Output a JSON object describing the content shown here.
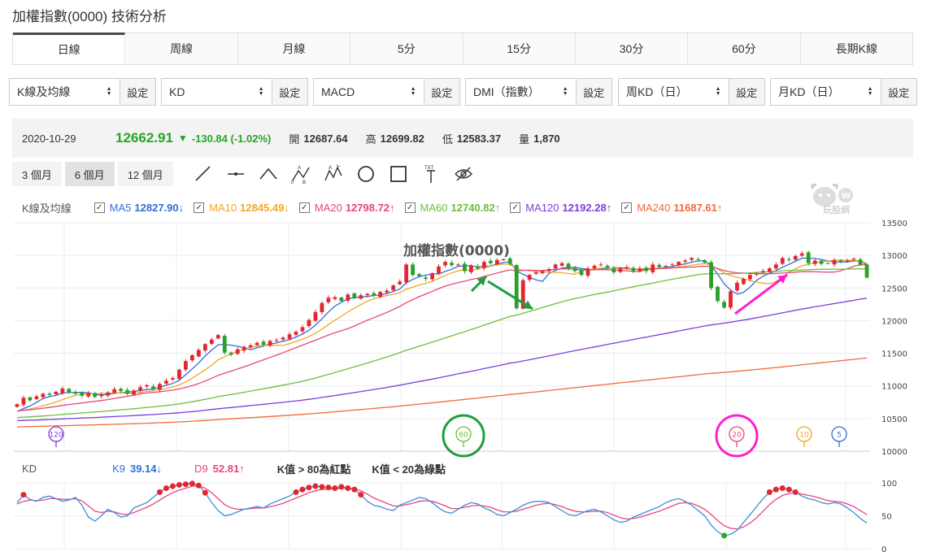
{
  "page": {
    "title": "加權指數(0000) 技術分析"
  },
  "tabs": [
    {
      "label": "日線",
      "active": true
    },
    {
      "label": "周線"
    },
    {
      "label": "月線"
    },
    {
      "label": "5分"
    },
    {
      "label": "15分"
    },
    {
      "label": "30分"
    },
    {
      "label": "60分"
    },
    {
      "label": "長期K線"
    }
  ],
  "selects": [
    {
      "value": "K線及均線",
      "button": "設定"
    },
    {
      "value": "KD",
      "button": "設定"
    },
    {
      "value": "MACD",
      "button": "設定"
    },
    {
      "value": "DMI（指數）",
      "button": "設定"
    },
    {
      "value": "周KD（日）",
      "button": "設定"
    },
    {
      "value": "月KD（日）",
      "button": "設定"
    }
  ],
  "quote": {
    "date": "2020-10-29",
    "price": "12662.91",
    "change": "-130.84 (-1.02%)",
    "open_label": "開",
    "open": "12687.64",
    "high_label": "高",
    "high": "12699.82",
    "low_label": "低",
    "low": "12583.37",
    "vol_label": "量",
    "vol": "1,870"
  },
  "periods": [
    {
      "label": "3 個月"
    },
    {
      "label": "6 個月",
      "active": true
    },
    {
      "label": "12 個月"
    }
  ],
  "tools": [
    "line-tool-icon",
    "hline-tool-icon",
    "peak-tool-icon",
    "abc-tool-icon",
    "abcd-tool-icon",
    "circle-tool-icon",
    "rect-tool-icon",
    "text-tool-icon",
    "hide-tool-icon"
  ],
  "ma_legend": {
    "title": "K線及均線",
    "items": [
      {
        "name": "MA5",
        "value": "12827.90",
        "arrow": "↓",
        "color": "#2f6fd6"
      },
      {
        "name": "MA10",
        "value": "12845.49",
        "arrow": "↓",
        "color": "#f5a623"
      },
      {
        "name": "MA20",
        "value": "12798.72",
        "arrow": "↑",
        "color": "#e8457a"
      },
      {
        "name": "MA60",
        "value": "12740.82",
        "arrow": "↑",
        "color": "#6cbf3c"
      },
      {
        "name": "MA120",
        "value": "12192.28",
        "arrow": "↑",
        "color": "#7b3fd9"
      },
      {
        "name": "MA240",
        "value": "11687.61",
        "arrow": "↑",
        "color": "#f06a3a"
      }
    ]
  },
  "logo_text": "玩股網",
  "kd": {
    "title": "KD",
    "k_label": "K9",
    "k_value": "39.14",
    "k_arrow": "↓",
    "d_label": "D9",
    "d_value": "52.81",
    "d_arrow": "↑",
    "note1": "K值 > 80為紅點",
    "note2": "K值 < 20為綠點"
  },
  "colors": {
    "up": "#e3262f",
    "down": "#2aa02a",
    "green_price": "#26a626"
  },
  "chart_data": [
    {
      "type": "candlestick",
      "title": "加權指數(0000)",
      "ylim": [
        10000,
        13500
      ],
      "yticks": [
        10000,
        10500,
        11000,
        11500,
        12000,
        12500,
        13000,
        13500
      ],
      "grid": true,
      "ma_markers": [
        {
          "label": "120",
          "color": "#7b3fd9"
        },
        {
          "label": "60",
          "color": "#6cbf3c",
          "highlight": true
        },
        {
          "label": "20",
          "color": "#e8457a",
          "highlight": true
        },
        {
          "label": "10",
          "color": "#f5a623"
        },
        {
          "label": "5",
          "color": "#2f6fd6"
        }
      ],
      "close": [
        10720,
        10820,
        10780,
        10840,
        10880,
        10860,
        10910,
        10960,
        10900,
        10880,
        10850,
        10890,
        10830,
        10870,
        10900,
        10950,
        10920,
        10880,
        10930,
        10980,
        11010,
        10950,
        11030,
        11080,
        11120,
        11250,
        11380,
        11470,
        11550,
        11640,
        11710,
        11780,
        11510,
        11480,
        11560,
        11600,
        11620,
        11660,
        11630,
        11690,
        11700,
        11740,
        11790,
        11830,
        11900,
        12010,
        12130,
        12270,
        12350,
        12360,
        12300,
        12400,
        12350,
        12390,
        12410,
        12380,
        12440,
        12460,
        12540,
        12600,
        12860,
        12700,
        12680,
        12640,
        12720,
        12830,
        12900,
        12850,
        12860,
        12760,
        12840,
        12800,
        12900,
        12880,
        12930,
        12940,
        12870,
        12190,
        12620,
        12700,
        12740,
        12760,
        12790,
        12860,
        12880,
        12800,
        12760,
        12700,
        12800,
        12840,
        12860,
        12810,
        12740,
        12800,
        12820,
        12760,
        12800,
        12760,
        12860,
        12820,
        12840,
        12860,
        12900,
        12920,
        12960,
        12930,
        12890,
        12500,
        12300,
        12200,
        12450,
        12580,
        12640,
        12700,
        12720,
        12760,
        12800,
        12860,
        12960,
        12940,
        12990,
        13030,
        12880,
        12920,
        12870,
        12880,
        12930,
        12900,
        12920,
        12950,
        12860,
        12660
      ],
      "series": [
        {
          "name": "MA5",
          "color": "#2f6fd6"
        },
        {
          "name": "MA10",
          "color": "#f5a623"
        },
        {
          "name": "MA20",
          "color": "#e8457a"
        },
        {
          "name": "MA60",
          "color": "#6cbf3c"
        },
        {
          "name": "MA120",
          "color": "#7b3fd9"
        },
        {
          "name": "MA240",
          "color": "#f06a3a"
        }
      ]
    },
    {
      "type": "line",
      "title": "KD",
      "ylim": [
        0,
        100
      ],
      "yticks": [
        0,
        50,
        100
      ],
      "k": [
        70,
        82,
        75,
        72,
        78,
        80,
        76,
        72,
        74,
        78,
        66,
        48,
        42,
        50,
        60,
        55,
        48,
        50,
        62,
        66,
        70,
        78,
        86,
        92,
        95,
        97,
        98,
        99,
        96,
        85,
        70,
        58,
        50,
        52,
        56,
        60,
        62,
        64,
        62,
        68,
        72,
        76,
        80,
        86,
        90,
        93,
        95,
        94,
        93,
        92,
        94,
        92,
        90,
        82,
        72,
        66,
        64,
        60,
        58,
        66,
        70,
        74,
        78,
        76,
        70,
        62,
        56,
        54,
        60,
        66,
        70,
        68,
        62,
        58,
        52,
        50,
        55,
        60,
        66,
        70,
        72,
        72,
        70,
        64,
        58,
        52,
        50,
        54,
        58,
        60,
        56,
        50,
        44,
        40,
        42,
        48,
        52,
        56,
        60,
        64,
        70,
        74,
        76,
        72,
        66,
        58,
        50,
        36,
        26,
        20,
        22,
        28,
        40,
        52,
        64,
        76,
        86,
        90,
        92,
        90,
        86,
        80,
        76,
        74,
        70,
        68,
        70,
        68,
        62,
        55,
        46,
        39
      ],
      "d": [
        68,
        72,
        74,
        73,
        74,
        76,
        76,
        75,
        75,
        76,
        73,
        65,
        57,
        55,
        57,
        56,
        53,
        52,
        55,
        59,
        63,
        68,
        74,
        80,
        85,
        89,
        92,
        95,
        95,
        92,
        85,
        76,
        67,
        62,
        60,
        60,
        61,
        62,
        62,
        64,
        66,
        69,
        73,
        77,
        81,
        85,
        88,
        90,
        91,
        91,
        92,
        92,
        91,
        88,
        83,
        77,
        73,
        69,
        65,
        65,
        67,
        69,
        72,
        73,
        72,
        69,
        65,
        61,
        61,
        63,
        65,
        66,
        65,
        63,
        59,
        56,
        56,
        57,
        60,
        63,
        66,
        68,
        69,
        67,
        64,
        60,
        57,
        56,
        56,
        57,
        57,
        55,
        51,
        47,
        45,
        46,
        48,
        51,
        54,
        57,
        61,
        65,
        69,
        70,
        69,
        65,
        60,
        52,
        43,
        35,
        31,
        30,
        33,
        39,
        47,
        57,
        67,
        75,
        81,
        84,
        85,
        83,
        81,
        79,
        76,
        73,
        72,
        71,
        68,
        64,
        58,
        52
      ],
      "red_dots": "K > 80",
      "green_dots": "K < 20"
    }
  ]
}
